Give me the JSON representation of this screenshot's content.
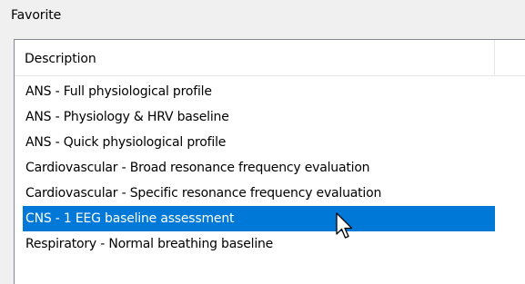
{
  "group": {
    "label": "Favorite"
  },
  "list": {
    "column_header": "Description",
    "items": [
      {
        "label": "ANS - Full physiological profile",
        "selected": false
      },
      {
        "label": "ANS - Physiology & HRV baseline",
        "selected": false
      },
      {
        "label": "ANS - Quick physiological profile",
        "selected": false
      },
      {
        "label": "Cardiovascular - Broad resonance frequency evaluation",
        "selected": false
      },
      {
        "label": "Cardiovascular - Specific resonance frequency evaluation",
        "selected": false
      },
      {
        "label": "CNS - 1 EEG baseline assessment",
        "selected": true
      },
      {
        "label": "Respiratory - Normal breathing baseline",
        "selected": false
      }
    ]
  },
  "colors": {
    "selection": "#0078d7",
    "window_bg": "#f0f0f0",
    "list_bg": "#ffffff"
  },
  "cursor": {
    "icon": "mouse-pointer-icon"
  }
}
